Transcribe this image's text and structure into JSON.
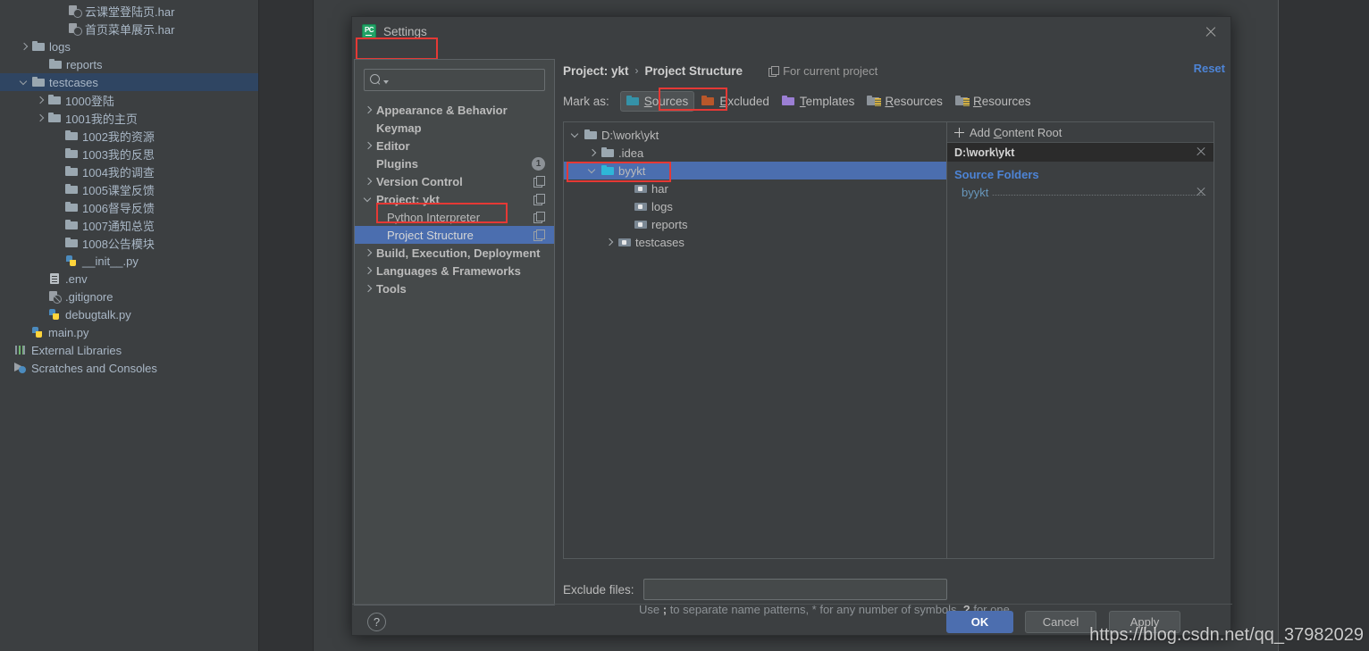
{
  "colors": {
    "accent_blue": "#4b6eaf",
    "link_blue": "#4d84d6",
    "source_folder_blue": "#6897bb",
    "highlight_red": "#e53935",
    "sources_teal": "#3592a8",
    "excluded_orange": "#b8572a",
    "templates_purple": "#9b7fd4",
    "dialog_bg": "#3c3f41",
    "ide_bg": "#2b2b2b"
  },
  "project_tree": {
    "rows": [
      {
        "label": "云课堂登陆页.har",
        "icon": "har-file-icon",
        "indent": 62,
        "arrow": "none",
        "selected": false
      },
      {
        "label": "首页菜单展示.har",
        "icon": "har-file-icon",
        "indent": 62,
        "arrow": "none",
        "selected": false
      },
      {
        "label": "logs",
        "icon": "folder-icon",
        "indent": 22,
        "arrow": "right",
        "selected": false
      },
      {
        "label": "reports",
        "icon": "folder-icon",
        "indent": 41,
        "arrow": "none",
        "selected": false
      },
      {
        "label": "testcases",
        "icon": "folder-icon",
        "indent": 22,
        "arrow": "down",
        "selected": true
      },
      {
        "label": "1000登陆",
        "icon": "folder-icon",
        "indent": 40,
        "arrow": "right",
        "selected": false
      },
      {
        "label": "1001我的主页",
        "icon": "folder-icon",
        "indent": 40,
        "arrow": "right",
        "selected": false
      },
      {
        "label": "1002我的资源",
        "icon": "folder-icon",
        "indent": 59,
        "arrow": "none",
        "selected": false
      },
      {
        "label": "1003我的反思",
        "icon": "folder-icon",
        "indent": 59,
        "arrow": "none",
        "selected": false
      },
      {
        "label": "1004我的调查",
        "icon": "folder-icon",
        "indent": 59,
        "arrow": "none",
        "selected": false
      },
      {
        "label": "1005课堂反馈",
        "icon": "folder-icon",
        "indent": 59,
        "arrow": "none",
        "selected": false
      },
      {
        "label": "1006督导反馈",
        "icon": "folder-icon",
        "indent": 59,
        "arrow": "none",
        "selected": false
      },
      {
        "label": "1007通知总览",
        "icon": "folder-icon",
        "indent": 59,
        "arrow": "none",
        "selected": false
      },
      {
        "label": "1008公告模块",
        "icon": "folder-icon",
        "indent": 59,
        "arrow": "none",
        "selected": false
      },
      {
        "label": "__init__.py",
        "icon": "python-file-icon",
        "indent": 59,
        "arrow": "none",
        "selected": false
      },
      {
        "label": ".env",
        "icon": "text-file-icon",
        "indent": 40,
        "arrow": "none",
        "selected": false
      },
      {
        "label": ".gitignore",
        "icon": "gitignore-file-icon",
        "indent": 40,
        "arrow": "none",
        "selected": false
      },
      {
        "label": "debugtalk.py",
        "icon": "python-file-icon",
        "indent": 40,
        "arrow": "none",
        "selected": false
      },
      {
        "label": "main.py",
        "icon": "python-file-icon",
        "indent": 21,
        "arrow": "none",
        "selected": false
      },
      {
        "label": "External Libraries",
        "icon": "libraries-icon",
        "indent": 2,
        "arrow": "none",
        "selected": false
      },
      {
        "label": "Scratches and Consoles",
        "icon": "scratches-icon",
        "indent": 2,
        "arrow": "none",
        "selected": false
      }
    ]
  },
  "dialog": {
    "title": "Settings",
    "app_icon": "pycharm-icon",
    "app_icon_text": "PC",
    "close_icon": "close-icon"
  },
  "search": {
    "value": "",
    "placeholder": "",
    "icon": "search-icon"
  },
  "nav": {
    "items": [
      {
        "label": "Appearance & Behavior",
        "arrow": "right",
        "child": false,
        "selected": false,
        "badge": null,
        "copy": false
      },
      {
        "label": "Keymap",
        "arrow": "none",
        "child": false,
        "selected": false,
        "badge": null,
        "copy": false
      },
      {
        "label": "Editor",
        "arrow": "right",
        "child": false,
        "selected": false,
        "badge": null,
        "copy": false
      },
      {
        "label": "Plugins",
        "arrow": "none",
        "child": false,
        "selected": false,
        "badge": "1",
        "copy": false
      },
      {
        "label": "Version Control",
        "arrow": "right",
        "child": false,
        "selected": false,
        "badge": null,
        "copy": true
      },
      {
        "label": "Project: ykt",
        "arrow": "down",
        "child": false,
        "selected": false,
        "badge": null,
        "copy": true
      },
      {
        "label": "Python Interpreter",
        "arrow": "none",
        "child": true,
        "selected": false,
        "badge": null,
        "copy": true
      },
      {
        "label": "Project Structure",
        "arrow": "none",
        "child": true,
        "selected": true,
        "badge": null,
        "copy": true
      },
      {
        "label": "Build, Execution, Deployment",
        "arrow": "right",
        "child": false,
        "selected": false,
        "badge": null,
        "copy": false
      },
      {
        "label": "Languages & Frameworks",
        "arrow": "right",
        "child": false,
        "selected": false,
        "badge": null,
        "copy": false
      },
      {
        "label": "Tools",
        "arrow": "right",
        "child": false,
        "selected": false,
        "badge": null,
        "copy": false
      }
    ]
  },
  "content": {
    "breadcrumb": {
      "parent": "Project: ykt",
      "separator": "›",
      "current": "Project Structure"
    },
    "scope_note": "For current project",
    "reset_label": "Reset",
    "mark_as_label": "Mark as:",
    "mark_buttons": [
      {
        "label_pre": "",
        "label_accel": "S",
        "label_post": "ources",
        "icon": "folder-sources-icon",
        "color": "teal",
        "active": true
      },
      {
        "label_pre": "",
        "label_accel": "E",
        "label_post": "xcluded",
        "icon": "folder-excluded-icon",
        "color": "orange",
        "active": false
      },
      {
        "label_pre": "",
        "label_accel": "T",
        "label_post": "emplates",
        "icon": "folder-templates-icon",
        "color": "purple",
        "active": false
      },
      {
        "label_pre": "",
        "label_accel": "R",
        "label_post": "esources",
        "icon": "folder-resources-icon",
        "color": "res",
        "active": false
      },
      {
        "label_pre": "",
        "label_accel": "R",
        "label_post": "esources",
        "icon": "folder-resources-icon",
        "color": "res",
        "active": false
      }
    ],
    "content_tree": [
      {
        "label": "D:\\work\\ykt",
        "icon": "folder-icon",
        "indent": 8,
        "arrow": "down",
        "selected": false
      },
      {
        "label": ".idea",
        "icon": "folder-icon",
        "indent": 27,
        "arrow": "right",
        "selected": false
      },
      {
        "label": "byykt",
        "icon": "folder-sources-icon",
        "indent": 27,
        "arrow": "down",
        "selected": true
      },
      {
        "label": "har",
        "icon": "folder-module-icon",
        "indent": 64,
        "arrow": "none",
        "selected": false
      },
      {
        "label": "logs",
        "icon": "folder-module-icon",
        "indent": 64,
        "arrow": "none",
        "selected": false
      },
      {
        "label": "reports",
        "icon": "folder-module-icon",
        "indent": 64,
        "arrow": "none",
        "selected": false
      },
      {
        "label": "testcases",
        "icon": "folder-module-icon",
        "indent": 46,
        "arrow": "right",
        "selected": false
      }
    ],
    "roots_panel": {
      "add_content_root": {
        "pre": "Add ",
        "accel": "C",
        "post": "ontent Root",
        "icon": "plus-icon"
      },
      "root_path": "D:\\work\\ykt",
      "root_close_icon": "close-icon",
      "source_folders_title": "Source Folders",
      "source_folders": [
        {
          "name": "byykt",
          "close_icon": "close-icon"
        }
      ]
    },
    "exclude": {
      "label": "Exclude files:",
      "value": "",
      "placeholder": "",
      "hint_a": "Use ",
      "hint_semicolon": ";",
      "hint_b": " to separate name patterns, * for any number of",
      "hint_c": "symbols, ",
      "hint_question": "?",
      "hint_d": " for one."
    }
  },
  "footer": {
    "help_label": "?",
    "ok_label": "OK",
    "cancel_label": "Cancel",
    "apply_label": "Apply"
  },
  "watermark": {
    "text": "https://blog.csdn.net/qq_37982029"
  }
}
